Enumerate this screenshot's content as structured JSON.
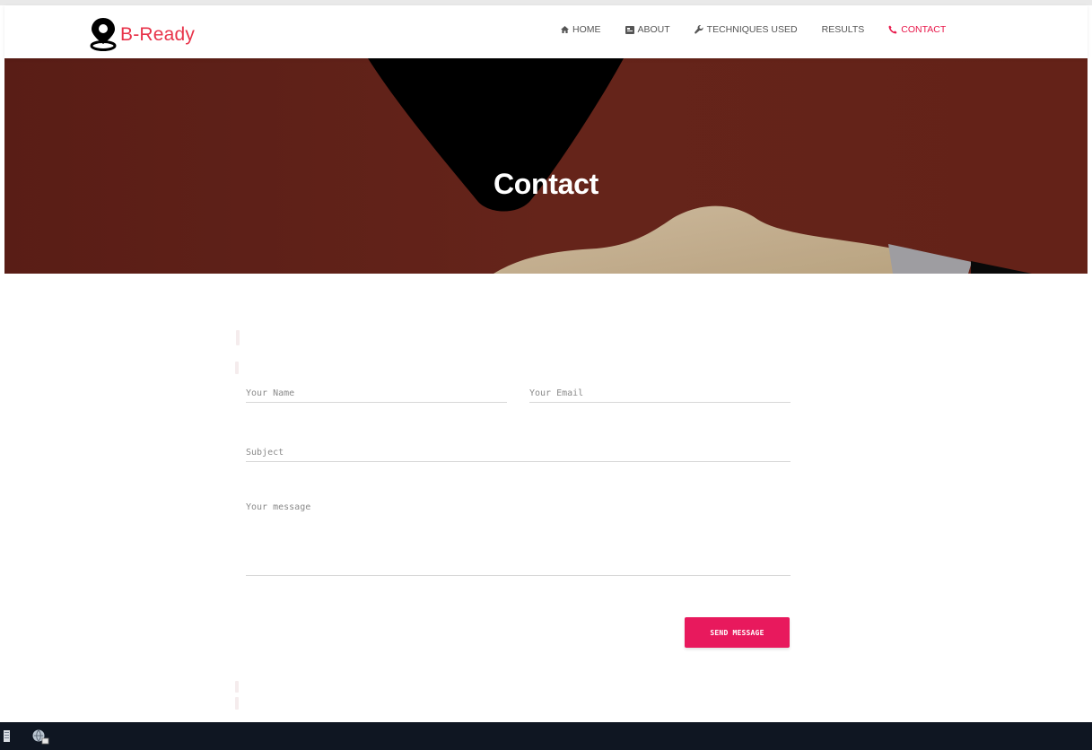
{
  "brand": {
    "name": "B-Ready",
    "color": "#e8334a"
  },
  "nav": {
    "items": [
      {
        "label": "HOME",
        "icon": "home-icon"
      },
      {
        "label": "ABOUT",
        "icon": "about-card-icon"
      },
      {
        "label": "TECHNIQUES USED",
        "icon": "wrench-icon"
      },
      {
        "label": "RESULTS",
        "icon": ""
      },
      {
        "label": "CONTACT",
        "icon": "phone-icon",
        "active": true
      }
    ],
    "active_color": "#e8174a"
  },
  "hero": {
    "title": "Contact"
  },
  "form": {
    "name_placeholder": "Your Name",
    "email_placeholder": "Your Email",
    "subject_placeholder": "Subject",
    "message_placeholder": "Your message",
    "submit_label": "SEND MESSAGE",
    "accent_color": "#e8195d"
  },
  "taskbar": {
    "icons": [
      "taskbar-document-icon",
      "taskbar-network-icon"
    ]
  }
}
